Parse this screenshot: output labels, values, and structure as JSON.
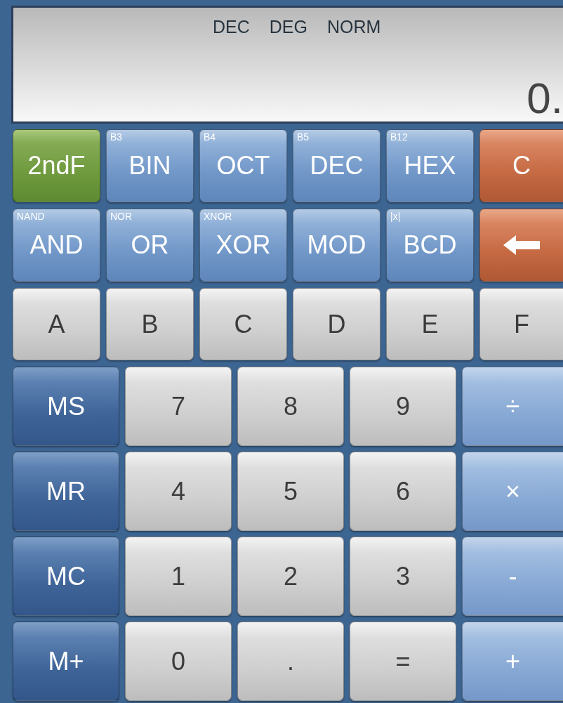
{
  "display": {
    "indicators": [
      "DEC",
      "DEG",
      "NORM"
    ],
    "value": "0."
  },
  "top_rows": [
    [
      {
        "kind": "green",
        "label": "2ndF"
      },
      {
        "kind": "blue",
        "label": "BIN",
        "sub": "B3"
      },
      {
        "kind": "blue",
        "label": "OCT",
        "sub": "B4"
      },
      {
        "kind": "blue",
        "label": "DEC",
        "sub": "B5"
      },
      {
        "kind": "blue",
        "label": "HEX",
        "sub": "B12"
      },
      {
        "kind": "orange",
        "label": "C"
      }
    ],
    [
      {
        "kind": "blue",
        "label": "AND",
        "sub": "NAND"
      },
      {
        "kind": "blue",
        "label": "OR",
        "sub": "NOR"
      },
      {
        "kind": "blue",
        "label": "XOR",
        "sub": "XNOR"
      },
      {
        "kind": "blue",
        "label": "MOD"
      },
      {
        "kind": "blue",
        "label": "BCD",
        "sub": "|x|"
      },
      {
        "kind": "backspace"
      }
    ],
    [
      {
        "kind": "gray",
        "label": "A"
      },
      {
        "kind": "gray",
        "label": "B"
      },
      {
        "kind": "gray",
        "label": "C"
      },
      {
        "kind": "gray",
        "label": "D"
      },
      {
        "kind": "gray",
        "label": "E"
      },
      {
        "kind": "gray",
        "label": "F"
      }
    ]
  ],
  "bottom_rows": [
    [
      {
        "kind": "memory",
        "label": "MS"
      },
      {
        "kind": "gray",
        "label": "7"
      },
      {
        "kind": "gray",
        "label": "8"
      },
      {
        "kind": "gray",
        "label": "9"
      },
      {
        "kind": "operator",
        "label": "÷"
      }
    ],
    [
      {
        "kind": "memory",
        "label": "MR"
      },
      {
        "kind": "gray",
        "label": "4"
      },
      {
        "kind": "gray",
        "label": "5"
      },
      {
        "kind": "gray",
        "label": "6"
      },
      {
        "kind": "operator",
        "label": "×"
      }
    ],
    [
      {
        "kind": "memory",
        "label": "MC"
      },
      {
        "kind": "gray",
        "label": "1"
      },
      {
        "kind": "gray",
        "label": "2"
      },
      {
        "kind": "gray",
        "label": "3"
      },
      {
        "kind": "operator",
        "label": "-"
      }
    ],
    [
      {
        "kind": "memory",
        "label": "M+"
      },
      {
        "kind": "gray",
        "label": "0"
      },
      {
        "kind": "gray",
        "label": "."
      },
      {
        "kind": "gray",
        "label": "="
      },
      {
        "kind": "operator",
        "label": "+"
      }
    ]
  ]
}
